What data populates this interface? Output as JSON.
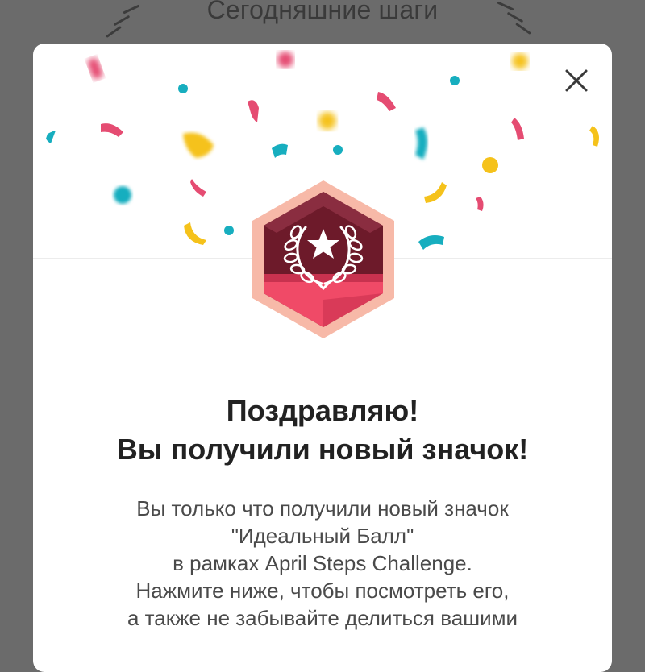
{
  "background": {
    "title": "Сегодняшние шаги"
  },
  "modal": {
    "close_icon": "close-icon",
    "badge_icon": "laurel-star-badge-icon",
    "heading_line1": "Поздравляю!",
    "heading_line2": "Вы получили новый значок!",
    "body_line1": "Вы только что получили новый значок",
    "body_line2": "\"Идеальный Балл\"",
    "body_line3": "в рамках April Steps Challenge.",
    "body_line4": "Нажмите ниже, чтобы посмотреть его,",
    "body_line5": "а также не забывайте делиться вашими"
  },
  "colors": {
    "overlay": "#6b6b6b",
    "badge_dark": "#6d1a2a",
    "badge_border": "#f7b9a8",
    "ribbon": "#f04a67",
    "confetti_pink": "#e54c72",
    "confetti_yellow": "#f5c21b",
    "confetti_teal": "#17aebf"
  }
}
